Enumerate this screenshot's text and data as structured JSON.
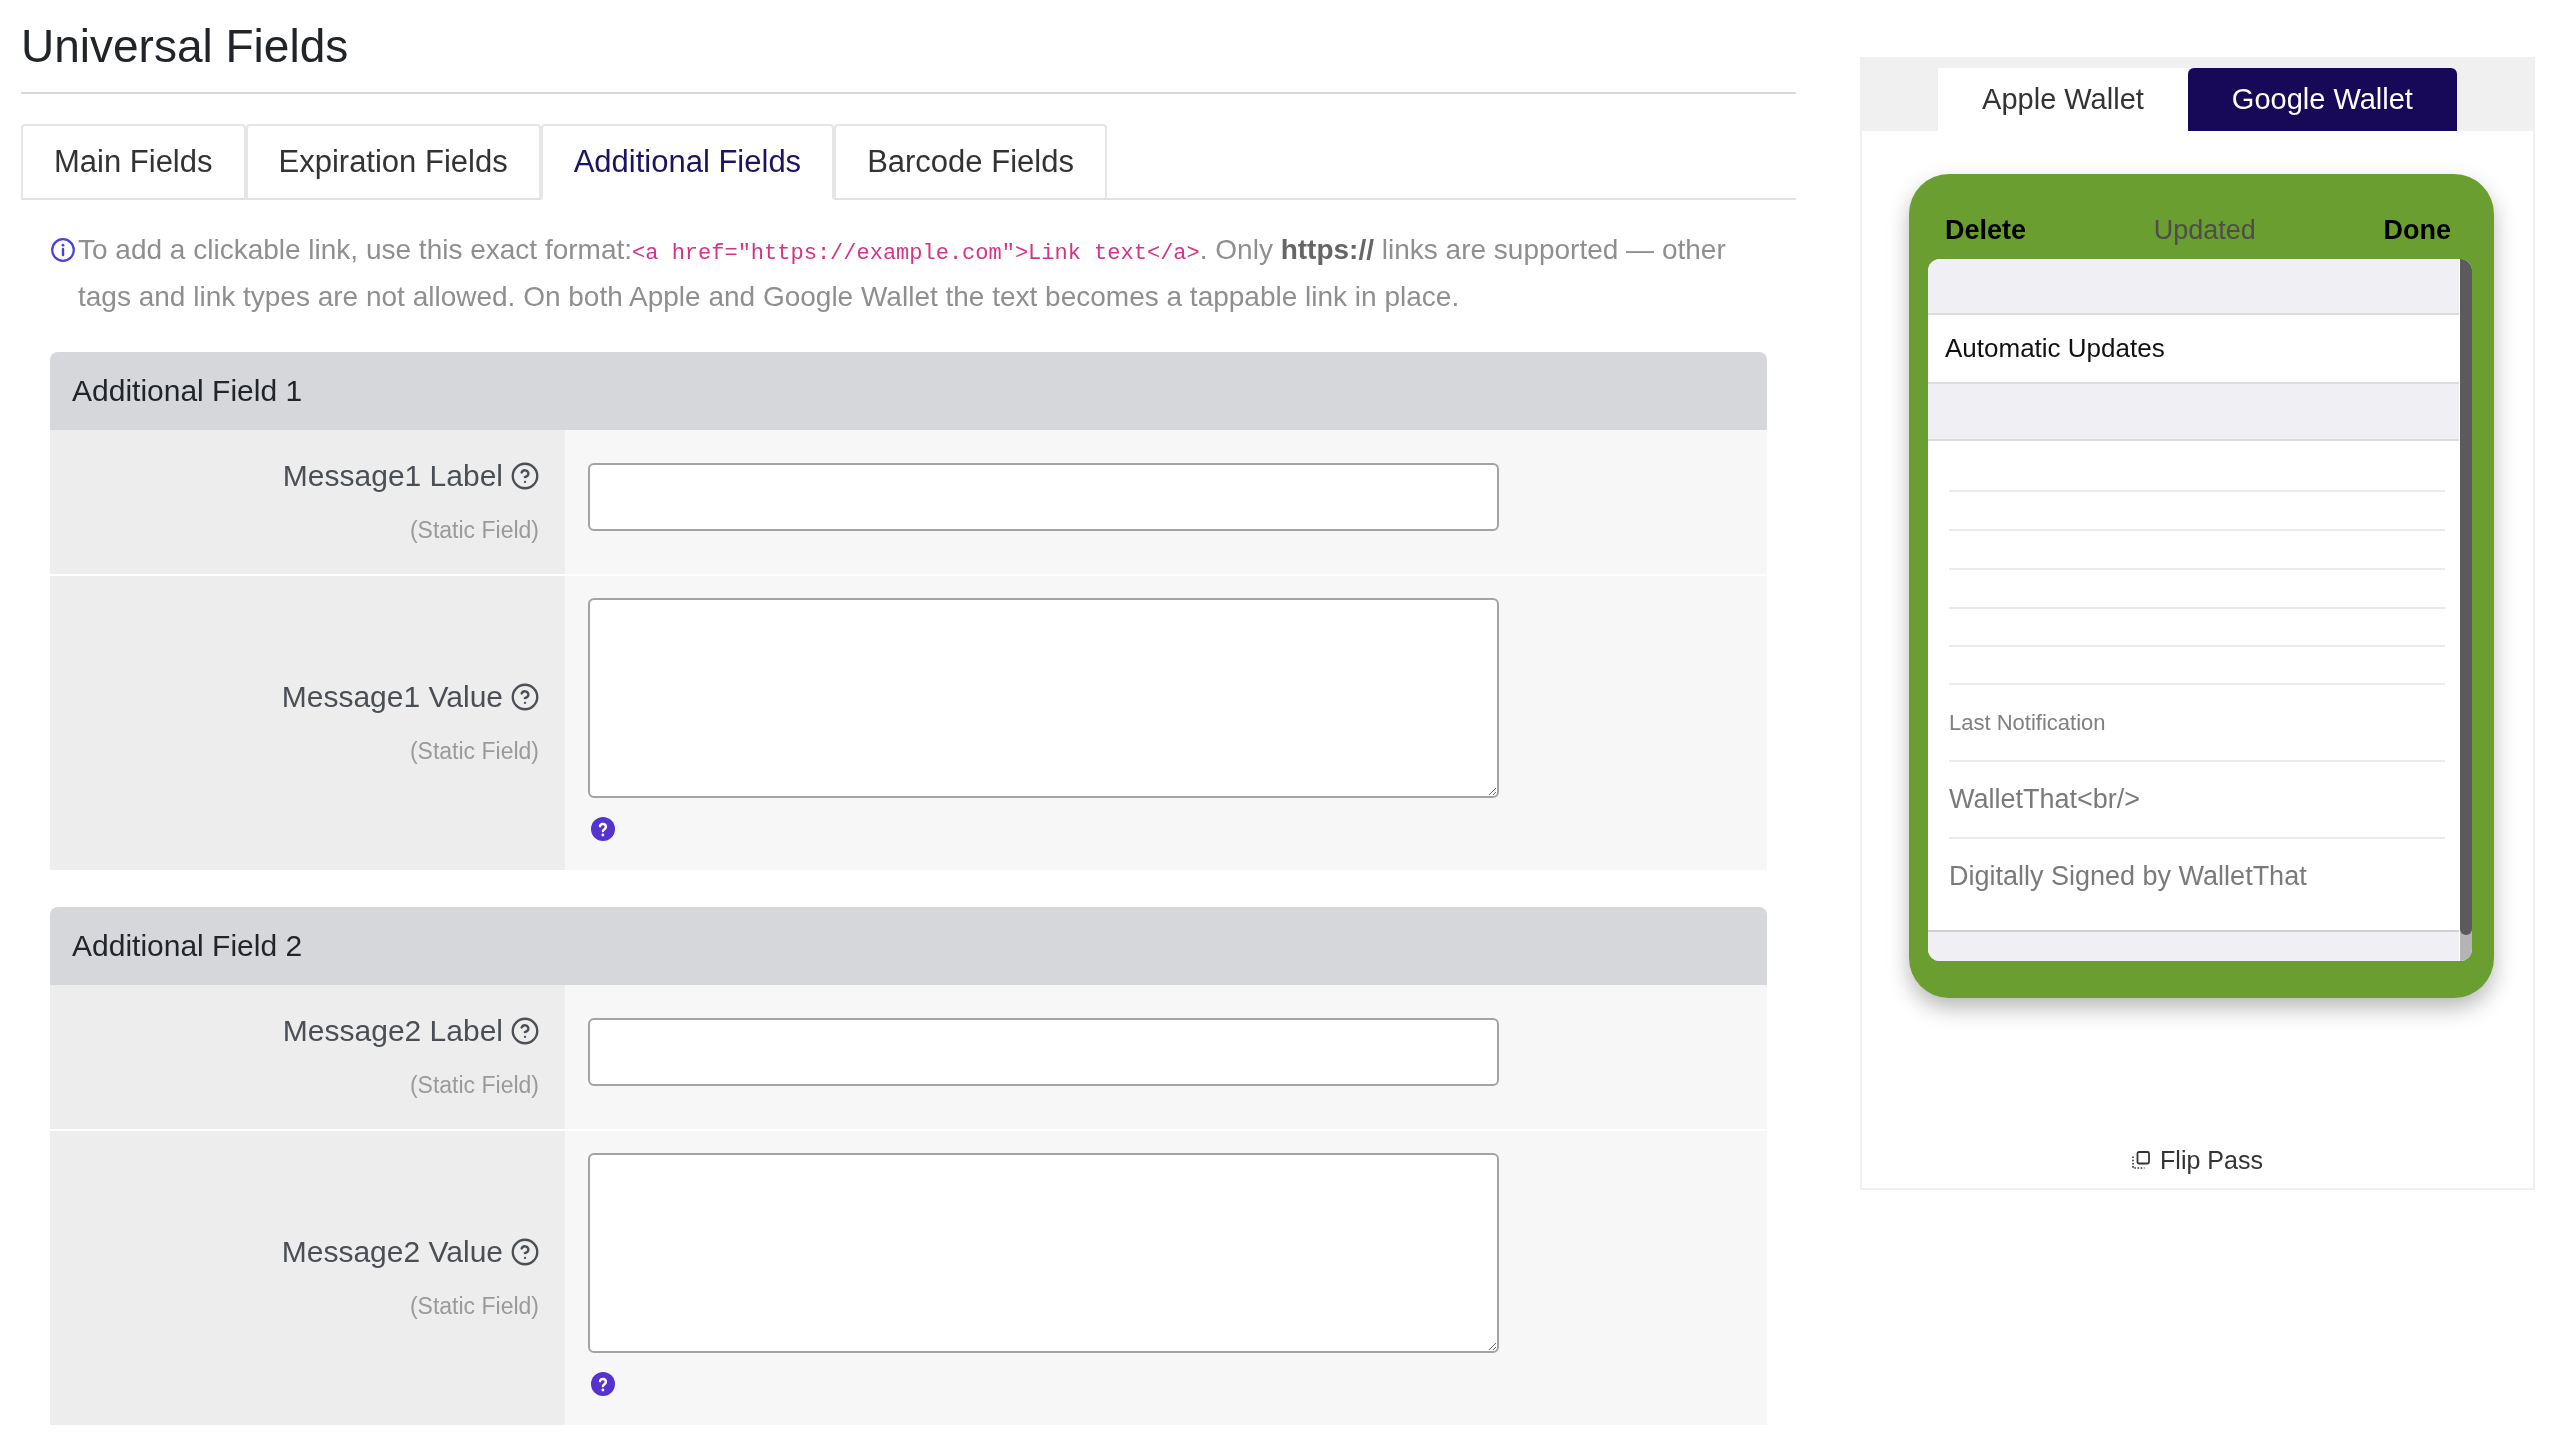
{
  "page": {
    "title": "Universal Fields"
  },
  "tabs": [
    {
      "label": "Main Fields",
      "selected": false
    },
    {
      "label": "Expiration Fields",
      "selected": false
    },
    {
      "label": "Additional Fields",
      "selected": true
    },
    {
      "label": "Barcode Fields",
      "selected": false
    }
  ],
  "notice": {
    "parts": [
      {
        "kind": "text",
        "text": "To add a clickable link, use this exact format:"
      },
      {
        "kind": "code",
        "text": "<a href=\"https://example.com\">Link text</a>"
      },
      {
        "kind": "text",
        "text": ". Only **https://** links are supported — other tags and link types are not allowed. On both Apple and Google Wallet the text becomes a tappable link in place."
      }
    ]
  },
  "sections": [
    {
      "title": "Additional Field 1",
      "rows": [
        {
          "kind": "input",
          "label": "Message1 Label",
          "note": "(Static Field)"
        },
        {
          "kind": "textarea",
          "label": "Message1 Value",
          "note": "(Static Field)"
        }
      ]
    },
    {
      "title": "Additional Field 2",
      "rows": [
        {
          "kind": "input",
          "label": "Message2 Label",
          "note": "(Static Field)"
        },
        {
          "kind": "textarea",
          "label": "Message2 Value",
          "note": "(Static Field)"
        }
      ]
    }
  ],
  "preview": {
    "tabs": [
      {
        "label": "Apple Wallet",
        "selected": false
      },
      {
        "label": "Google Wallet",
        "selected": true
      }
    ],
    "pass": {
      "header": [
        {
          "label": "Delete",
          "disabled": false
        },
        {
          "label": "Updated",
          "disabled": true
        },
        {
          "label": "Done",
          "disabled": false
        }
      ],
      "setting": "Automatic Updates",
      "fields": [
        {
          "kind": "caption",
          "text": "Last Notification"
        },
        {
          "kind": "value",
          "text": "WalletThat<br/>"
        },
        {
          "kind": "value",
          "text": "Digitally Signed by WalletThat"
        }
      ]
    },
    "flip": "Flip Pass"
  }
}
